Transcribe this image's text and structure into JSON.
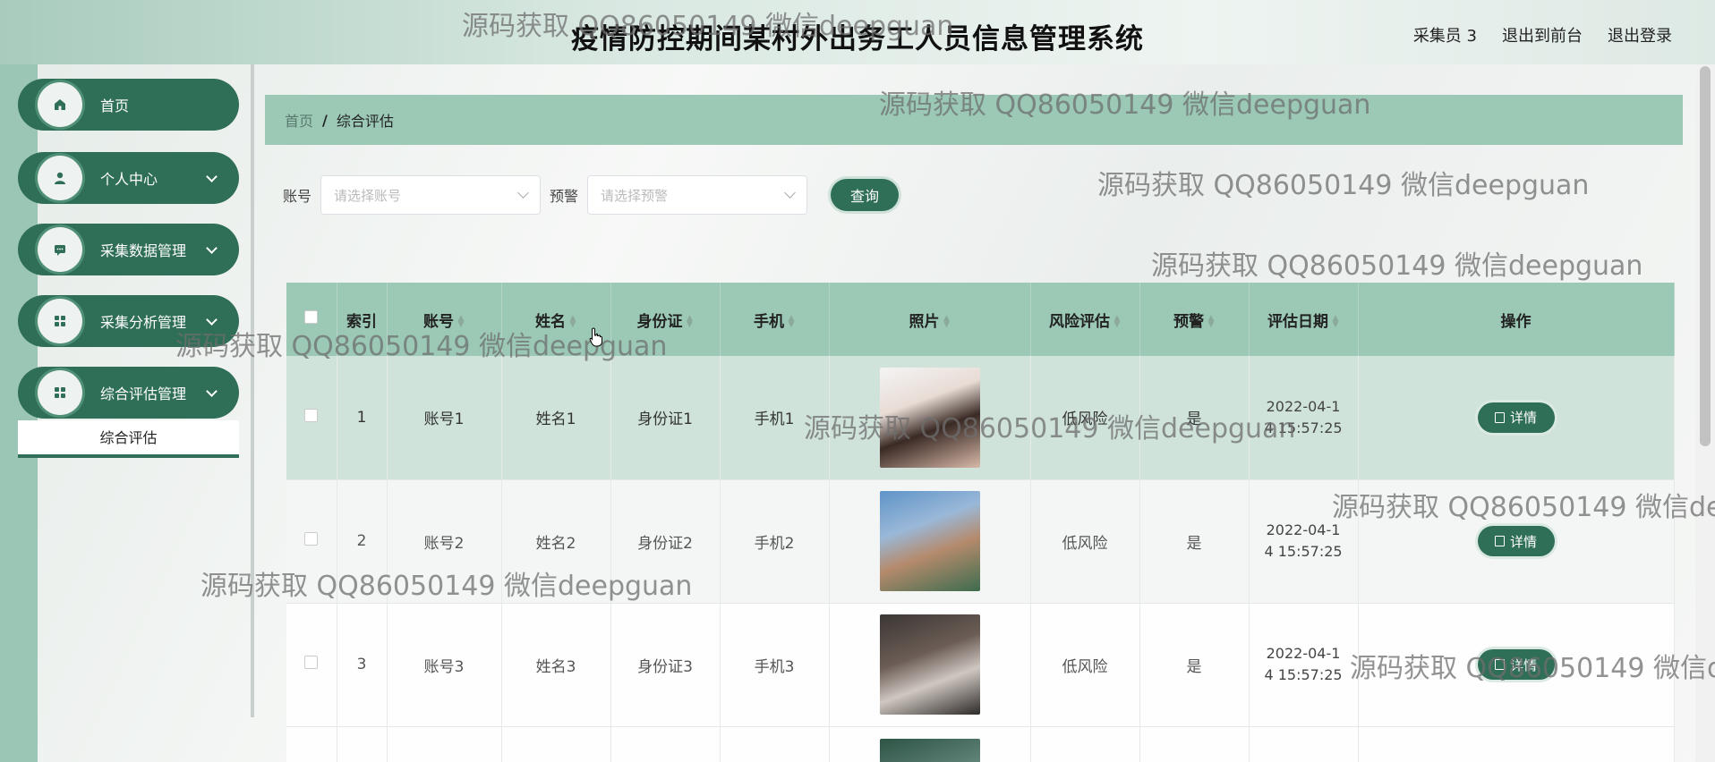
{
  "header": {
    "title": "疫情防控期间某村外出务工人员信息管理系统",
    "user": "采集员 3",
    "front": "退出到前台",
    "logout": "退出登录"
  },
  "sidebar": {
    "items": [
      {
        "label": "首页",
        "icon": "home-icon",
        "arrow": false
      },
      {
        "label": "个人中心",
        "icon": "user-icon",
        "arrow": true
      },
      {
        "label": "采集数据管理",
        "icon": "chat-icon",
        "arrow": true
      },
      {
        "label": "采集分析管理",
        "icon": "grid-icon",
        "arrow": true
      },
      {
        "label": "综合评估管理",
        "icon": "grid-icon",
        "arrow": true
      }
    ],
    "subitem": "综合评估"
  },
  "breadcrumb": {
    "home": "首页",
    "sep": "/",
    "current": "综合评估"
  },
  "search": {
    "account_label": "账号",
    "account_placeholder": "请选择账号",
    "warn_label": "预警",
    "warn_placeholder": "请选择预警",
    "query": "查询"
  },
  "table": {
    "headers": [
      "索引",
      "账号",
      "姓名",
      "身份证",
      "手机",
      "照片",
      "风险评估",
      "预警",
      "评估日期",
      "操作"
    ],
    "rows": [
      {
        "index": "1",
        "account": "账号1",
        "name": "姓名1",
        "id": "身份证1",
        "phone": "手机1",
        "risk": "低风险",
        "warn": "是",
        "date": "2022-04-1",
        "time": "4 15:57:25",
        "action": "详情"
      },
      {
        "index": "2",
        "account": "账号2",
        "name": "姓名2",
        "id": "身份证2",
        "phone": "手机2",
        "risk": "低风险",
        "warn": "是",
        "date": "2022-04-1",
        "time": "4 15:57:25",
        "action": "详情"
      },
      {
        "index": "3",
        "account": "账号3",
        "name": "姓名3",
        "id": "身份证3",
        "phone": "手机3",
        "risk": "低风险",
        "warn": "是",
        "date": "2022-04-1",
        "time": "4 15:57:25",
        "action": "详情"
      }
    ]
  },
  "watermark": "源码获取 QQ86050149 微信deepguan",
  "colors": {
    "primary": "#2f6e57",
    "header_bg": "#9bc9b6",
    "row_highlight": "#cfe3da"
  }
}
